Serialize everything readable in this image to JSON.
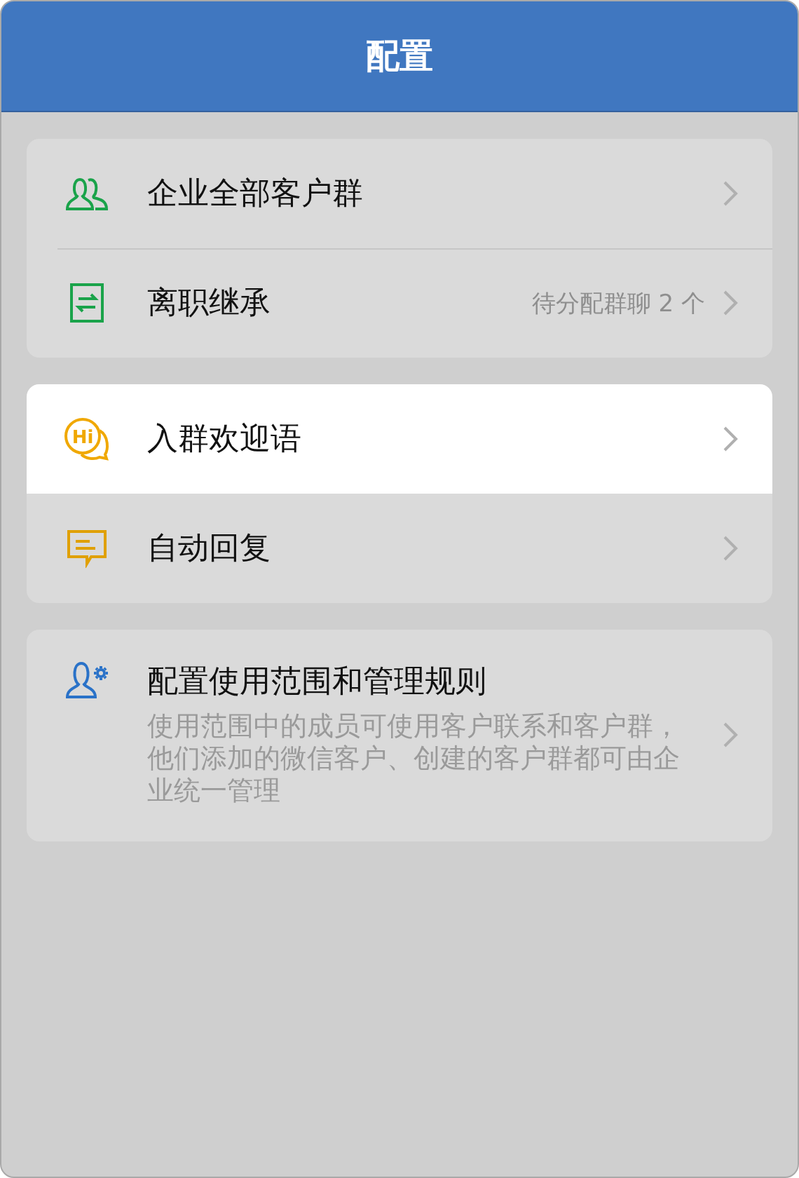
{
  "header": {
    "title": "配置"
  },
  "groups": [
    {
      "items": [
        {
          "kind": "group",
          "title": "企业全部客户群",
          "selected": false
        },
        {
          "kind": "transfer",
          "title": "离职继承",
          "note": "待分配群聊 2 个",
          "selected": false
        }
      ]
    },
    {
      "items": [
        {
          "kind": "hi",
          "icon_text": "Hi",
          "title": "入群欢迎语",
          "selected": true
        },
        {
          "kind": "message",
          "title": "自动回复",
          "selected": false
        }
      ]
    },
    {
      "items": [
        {
          "kind": "user-gear",
          "title": "配置使用范围和管理规则",
          "description": "使用范围中的成员可使用客户联系和客户群，他们添加的微信客户、创建的客户群都可由企业统一管理",
          "selected": false
        }
      ]
    }
  ]
}
